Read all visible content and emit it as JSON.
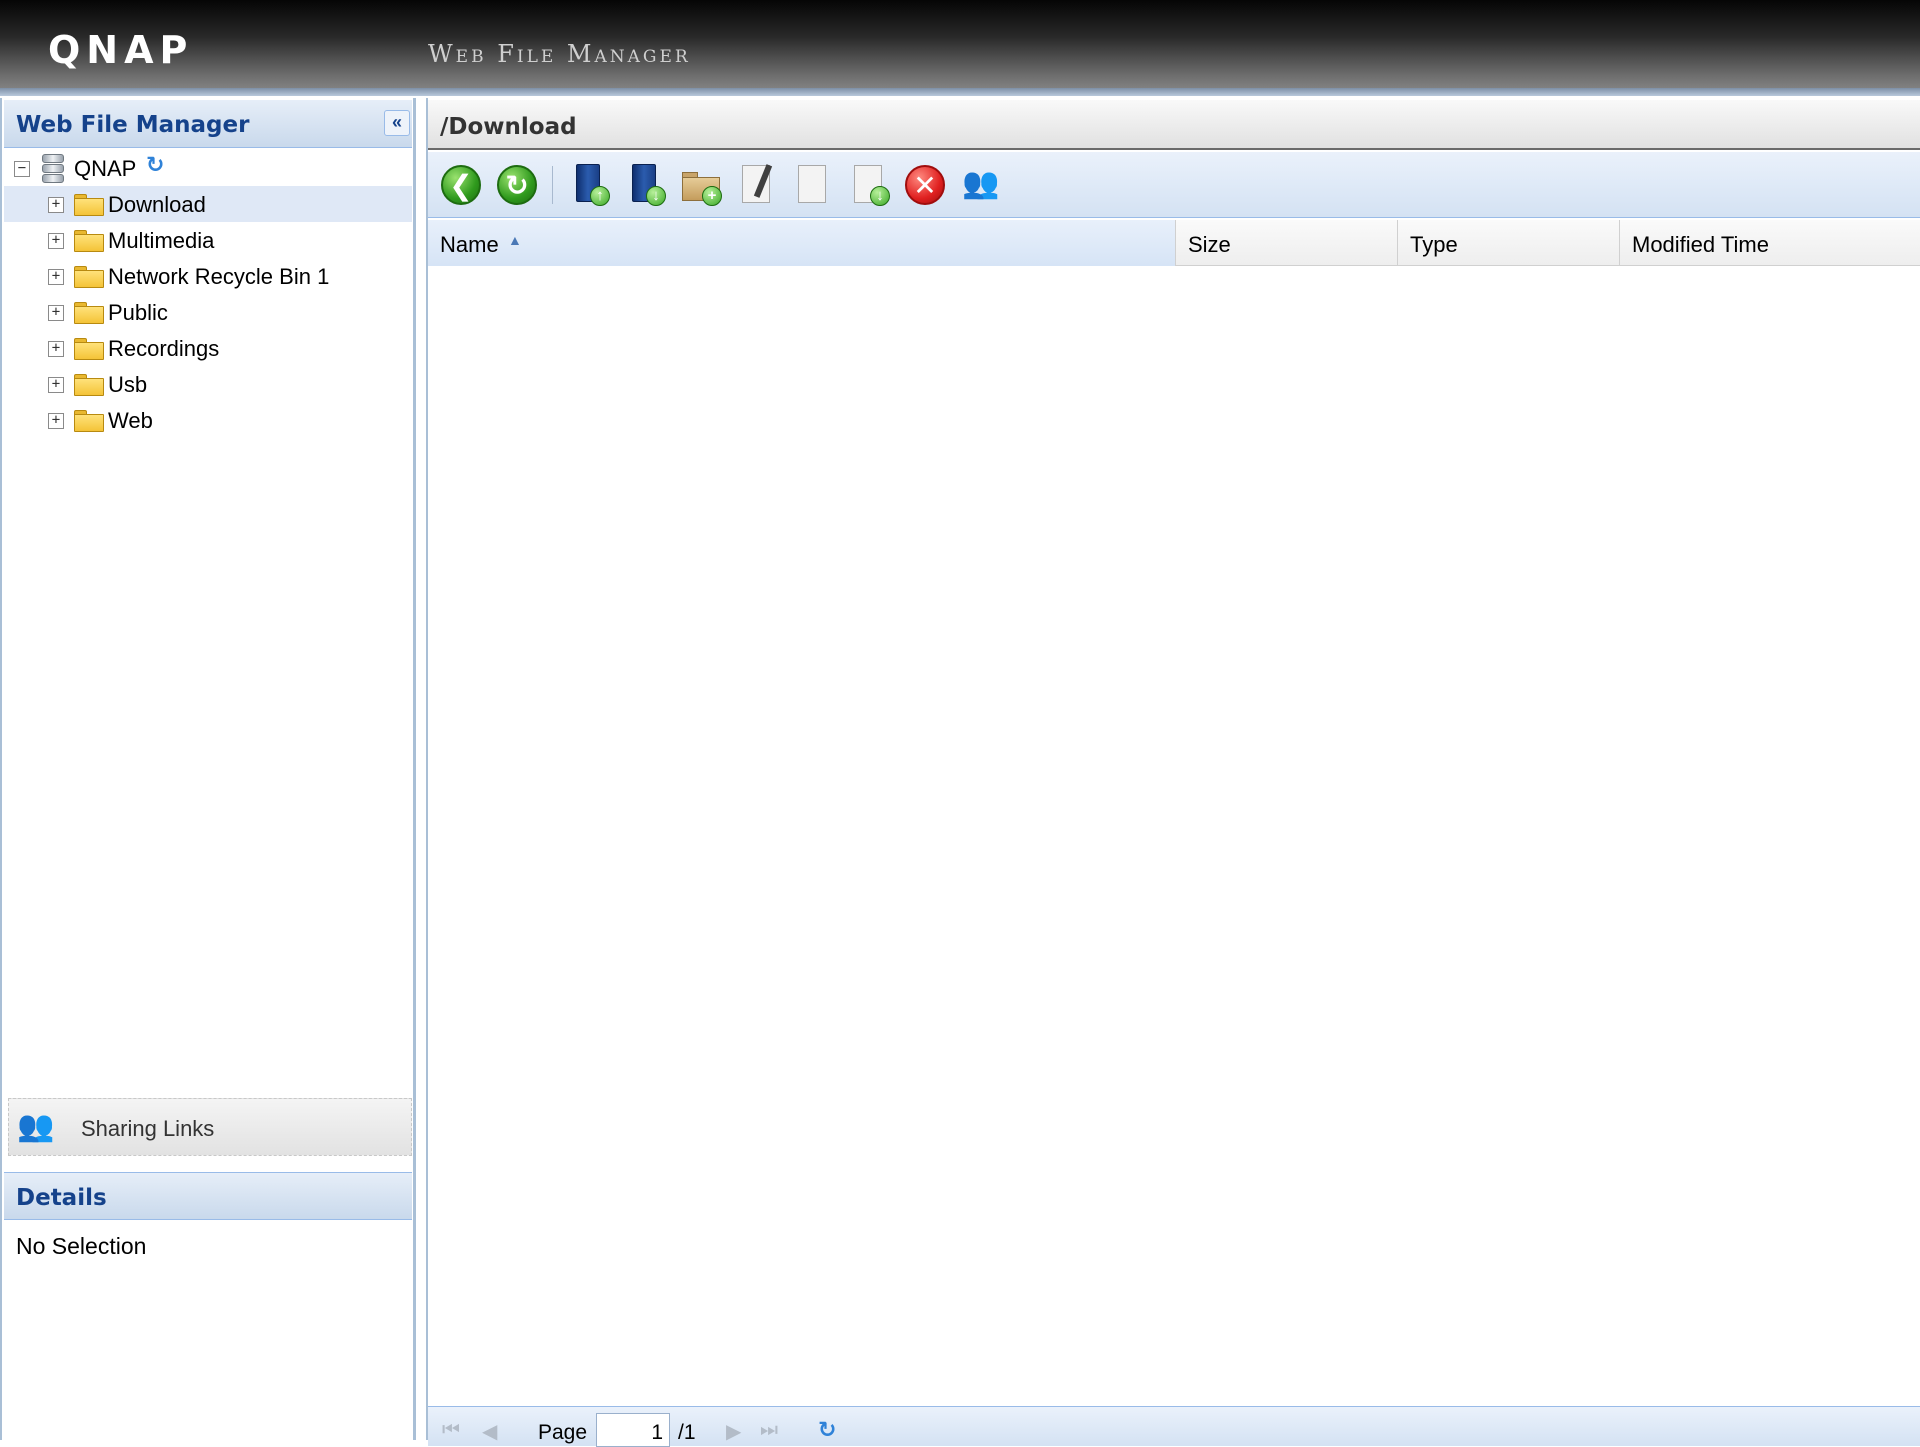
{
  "banner": {
    "logo": "QNAP",
    "app_name": "Web File Manager"
  },
  "left_panel": {
    "title": "Web File Manager",
    "collapse_icon": "«",
    "tree": {
      "root": {
        "label": "QNAP",
        "expander": "−"
      },
      "folders": [
        {
          "label": "Download",
          "expander": "+",
          "selected": true
        },
        {
          "label": "Multimedia",
          "expander": "+"
        },
        {
          "label": "Network Recycle Bin 1",
          "expander": "+"
        },
        {
          "label": "Public",
          "expander": "+"
        },
        {
          "label": "Recordings",
          "expander": "+"
        },
        {
          "label": "Usb",
          "expander": "+"
        },
        {
          "label": "Web",
          "expander": "+"
        }
      ]
    },
    "sharing_links": "Sharing Links",
    "details": {
      "title": "Details",
      "text": "No Selection"
    }
  },
  "main": {
    "path": "/Download",
    "toolbar": {
      "icons": [
        "back-icon",
        "refresh-icon",
        "upload-icon",
        "download-icon",
        "new-folder-icon",
        "rename-icon",
        "copy-icon",
        "move-icon",
        "delete-icon",
        "share-icon"
      ],
      "glyphs": {
        "back": "❮",
        "refresh": "↻",
        "up": "↑",
        "down": "↓",
        "plus": "+",
        "delete": "✕",
        "share": "👥"
      }
    },
    "columns": [
      "Name",
      "Size",
      "Type",
      "Modified Time"
    ],
    "sort_arrow": "▲",
    "paging": {
      "first": "⏮",
      "prev": "◀",
      "next": "▶",
      "last": "⏭",
      "page_label": "Page",
      "page_value": "1",
      "page_of": "/1",
      "refresh": "↻"
    }
  },
  "colors": {
    "accent": "#15428b",
    "header_bg": "#c9d9ec",
    "selected_row": "#dfe8f6"
  }
}
